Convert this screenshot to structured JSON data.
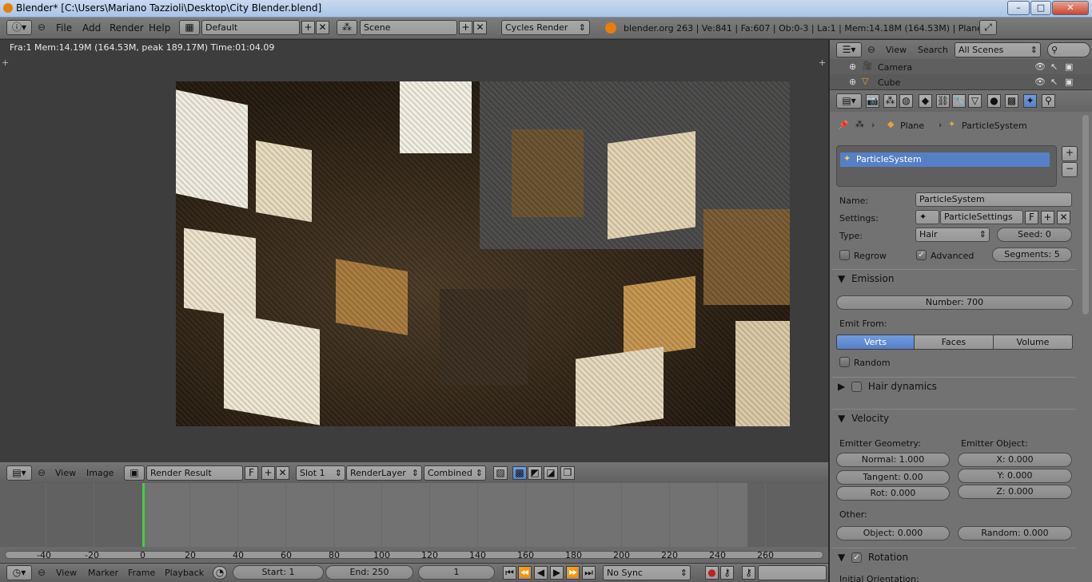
{
  "window": {
    "title": "Blender* [C:\\Users\\Mariano Tazzioli\\Desktop\\City Blender.blend]",
    "minimize": "–",
    "maximize": "□",
    "close": "✕"
  },
  "info_header": {
    "menus": [
      "File",
      "Add",
      "Render",
      "Help"
    ],
    "screen_layout": "Default",
    "scene": "Scene",
    "render_engine": "Cycles Render",
    "stats": "blender.org 263 | Ve:841 | Fa:607 | Ob:0-3 | La:1 | Mem:14.18M (164.53M) | Plane"
  },
  "image_editor": {
    "render_info": "Fra:1  Mem:14.19M (164.53M, peak 189.17M) Time:01:04.09",
    "header": {
      "menus": [
        "View",
        "Image"
      ],
      "image_name": "Render Result",
      "fake_user": "F",
      "slot": "Slot 1",
      "render_layer": "RenderLayer",
      "pass": "Combined"
    }
  },
  "timeline": {
    "ruler_labels": [
      "-40",
      "-20",
      "0",
      "20",
      "40",
      "60",
      "80",
      "100",
      "120",
      "140",
      "160",
      "180",
      "200",
      "220",
      "240",
      "260"
    ],
    "current_frame_marker": "0",
    "header": {
      "menus": [
        "View",
        "Marker",
        "Frame",
        "Playback"
      ],
      "start": "Start: 1",
      "end": "End: 250",
      "current": "1",
      "sync": "No Sync"
    }
  },
  "outliner": {
    "menus": [
      "View",
      "Search"
    ],
    "filter": "All Scenes",
    "items": [
      {
        "label": "Camera"
      },
      {
        "label": "Cube"
      }
    ]
  },
  "properties": {
    "breadcrumb": [
      "Plane",
      "ParticleSystem"
    ],
    "list_item": "ParticleSystem",
    "name_label": "Name:",
    "name_value": "ParticleSystem",
    "settings_label": "Settings:",
    "settings_value": "ParticleSettings",
    "settings_fake": "F",
    "type_label": "Type:",
    "type_value": "Hair",
    "seed": "Seed: 0",
    "regrow": "Regrow",
    "advanced": "Advanced",
    "segments": "Segments: 5",
    "emission": {
      "title": "Emission",
      "number": "Number: 700",
      "emit_from_label": "Emit From:",
      "options": [
        "Verts",
        "Faces",
        "Volume"
      ],
      "active_option": "Verts",
      "random": "Random"
    },
    "hair_dynamics": {
      "title": "Hair dynamics"
    },
    "velocity": {
      "title": "Velocity",
      "emitter_geometry_label": "Emitter Geometry:",
      "emitter_object_label": "Emitter Object:",
      "normal": "Normal: 1.000",
      "tangent": "Tangent: 0.00",
      "rot": "Rot: 0.000",
      "x": "X: 0.000",
      "y": "Y: 0.000",
      "z": "Z: 0.000",
      "other_label": "Other:",
      "object": "Object: 0.000",
      "random": "Random: 0.000"
    },
    "rotation": {
      "title": "Rotation",
      "initial_orientation": "Initial Orientation:"
    }
  },
  "colors": {
    "accent_blue": "#5680c6",
    "playhead_green": "#3fd03f",
    "header_gray": "#6a6a6a",
    "panel_gray": "#727272"
  }
}
